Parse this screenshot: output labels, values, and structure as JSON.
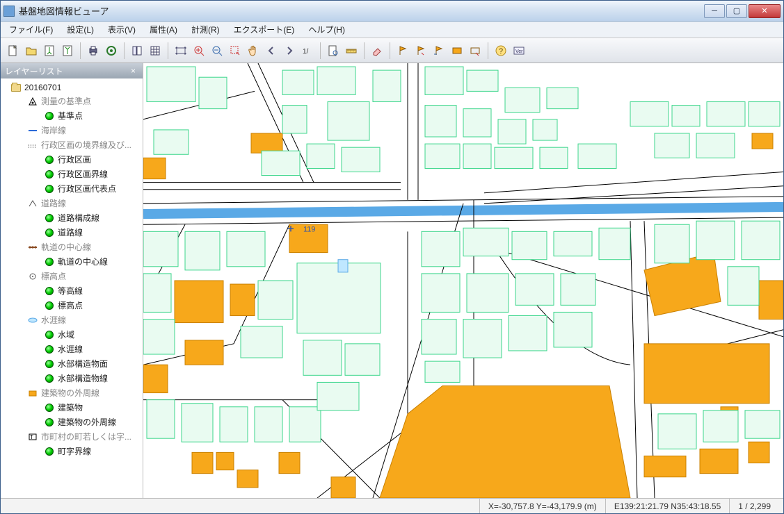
{
  "window": {
    "title": "基盤地図情報ビューア"
  },
  "menu": {
    "file": "ファイル(F)",
    "settings": "設定(L)",
    "view": "表示(V)",
    "attributes": "属性(A)",
    "measure": "計測(R)",
    "export": "エクスポート(E)",
    "help": "ヘルプ(H)"
  },
  "sidebar": {
    "title": "レイヤーリスト",
    "root": "20160701",
    "groups": [
      {
        "name": "測量の基準点",
        "layers": [
          "基準点"
        ]
      },
      {
        "name": "海岸線",
        "layers": []
      },
      {
        "name": "行政区画の境界線及び...",
        "layers": [
          "行政区画",
          "行政区画界線",
          "行政区画代表点"
        ]
      },
      {
        "name": "道路線",
        "layers": [
          "道路構成線",
          "道路線"
        ]
      },
      {
        "name": "軌道の中心線",
        "layers": [
          "軌道の中心線"
        ]
      },
      {
        "name": "標高点",
        "layers": [
          "等高線",
          "標高点"
        ]
      },
      {
        "name": "水涯線",
        "layers": [
          "水域",
          "水涯線",
          "水部構造物面",
          "水部構造物線"
        ]
      },
      {
        "name": "建築物の外周線",
        "layers": [
          "建築物",
          "建築物の外周線"
        ]
      },
      {
        "name": "市町村の町若しくは字...",
        "layers": [
          "町字界線"
        ]
      }
    ]
  },
  "map": {
    "annotation": "119"
  },
  "status": {
    "xy": "X=-30,757.8 Y=-43,179.9 (m)",
    "lonlat": "E139:21:21.79 N35:43:18.55",
    "scale": "1 / 2,299"
  },
  "colors": {
    "road": "#000000",
    "building_outline": "#3dd68c",
    "building_fill_light": "#e2fbef",
    "building_highlight": "#f7a81b",
    "water": "#bfe7ff",
    "water_edge": "#5aa9e6"
  }
}
